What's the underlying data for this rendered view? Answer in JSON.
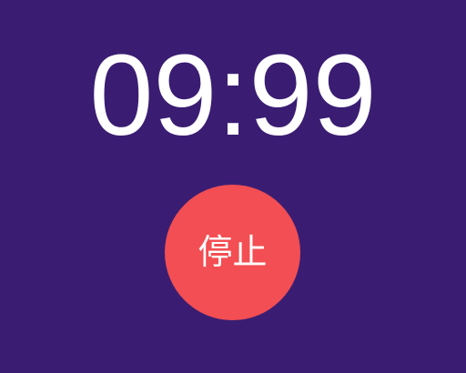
{
  "timer": {
    "display": "09:99"
  },
  "controls": {
    "stop_label": "停止"
  },
  "colors": {
    "background": "#3a1d72",
    "timer_text": "#ffffff",
    "stop_button": "#f24e53"
  }
}
